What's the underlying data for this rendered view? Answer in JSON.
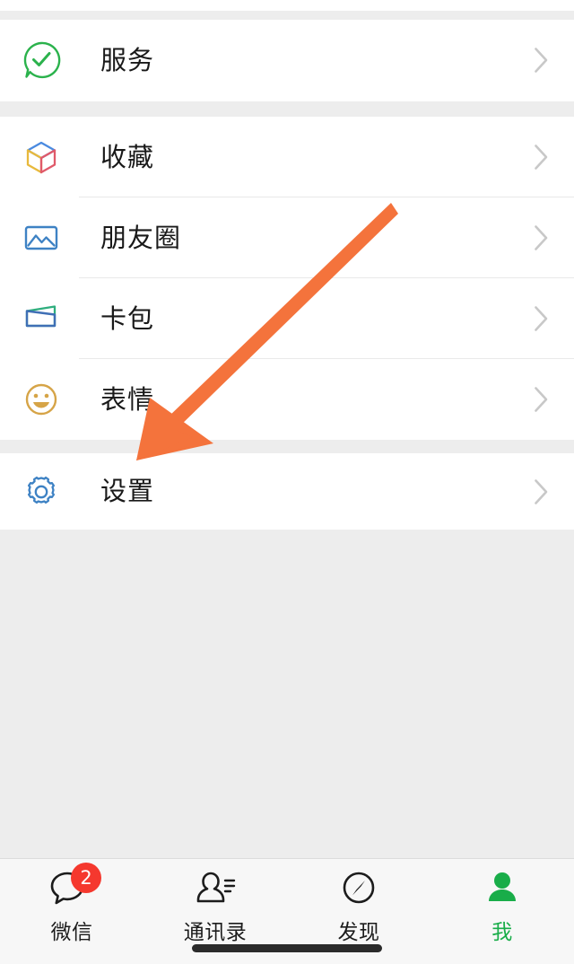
{
  "app": {
    "name": "WeChat",
    "screen": "me",
    "accent_green": "#19ad49",
    "badge_red": "#f5382e",
    "background_gray": "#ededed",
    "card_white": "#ffffff",
    "separator_gray": "#e9e9e9",
    "annotation_orange": "#f4733c"
  },
  "sections": [
    {
      "id": "services",
      "rows": [
        {
          "label": "服务",
          "icon": "services-check-bubble-icon",
          "icon_color": "#2bb24c",
          "chevron": "chevron-right-icon"
        }
      ]
    },
    {
      "id": "group",
      "rows": [
        {
          "label": "收藏",
          "icon": "favorites-cube-icon",
          "icon_color": "#4a7fd4",
          "chevron": "chevron-right-icon"
        },
        {
          "label": "朋友圈",
          "icon": "moments-photo-icon",
          "icon_color": "#3e82c4",
          "chevron": "chevron-right-icon"
        },
        {
          "label": "卡包",
          "icon": "cards-wallet-icon",
          "icon_color": "#3f6fb5",
          "chevron": "chevron-right-icon"
        },
        {
          "label": "表情",
          "icon": "stickers-smiley-icon",
          "icon_color": "#d6a martin",
          "chevron": "chevron-right-icon"
        }
      ]
    },
    {
      "id": "settings",
      "rows": [
        {
          "label": "设置",
          "icon": "settings-gear-icon",
          "icon_color": "#3e82c4",
          "chevron": "chevron-right-icon"
        }
      ]
    }
  ],
  "tabbar": {
    "tabs": [
      {
        "label": "微信",
        "icon": "chat-bubble-icon",
        "badge": "2",
        "active": false
      },
      {
        "label": "通讯录",
        "icon": "contacts-person-icon",
        "badge": "",
        "active": false
      },
      {
        "label": "发现",
        "icon": "discover-compass-icon",
        "badge": "",
        "active": false
      },
      {
        "label": "我",
        "icon": "profile-person-icon",
        "badge": "",
        "active": true
      }
    ]
  },
  "annotation": {
    "arrow": "orange-pointer-arrow",
    "points_to": "设置",
    "color": "#f4733c"
  }
}
